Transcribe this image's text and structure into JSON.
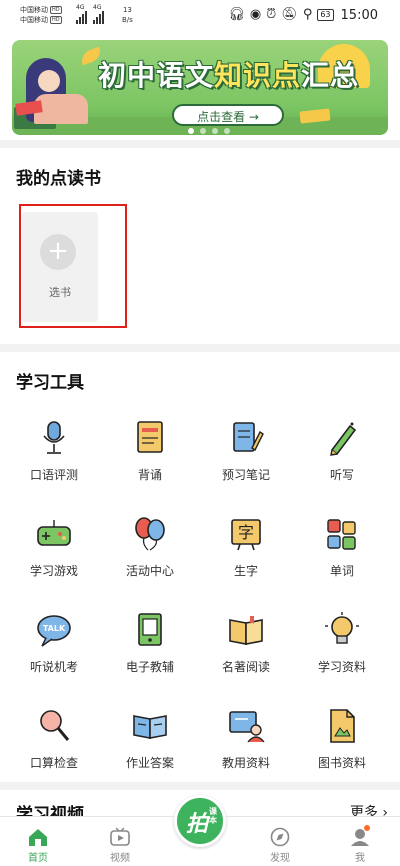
{
  "status_bar": {
    "carrier_1": "中国移动",
    "carrier_2": "中国移动",
    "hd_badge": "HD",
    "signal_1": "4G",
    "signal_2": "4G",
    "net_speed": "13",
    "net_speed_unit": "B/s",
    "battery": "63",
    "time": "15:00"
  },
  "banner": {
    "title_part1": "初中语文",
    "title_highlight": "知识点",
    "title_part2": "汇总",
    "button_label": "点击查看 →",
    "dots_total": 4,
    "dots_active": 0
  },
  "my_books": {
    "title": "我的点读书",
    "add_label": "选书"
  },
  "tools": {
    "title": "学习工具",
    "items": [
      {
        "label": "口语评测",
        "icon": "microphone-icon"
      },
      {
        "label": "背诵",
        "icon": "book-icon"
      },
      {
        "label": "预习笔记",
        "icon": "notebook-pen-icon"
      },
      {
        "label": "听写",
        "icon": "pencil-icon"
      },
      {
        "label": "学习游戏",
        "icon": "gamepad-icon"
      },
      {
        "label": "活动中心",
        "icon": "balloons-icon"
      },
      {
        "label": "生字",
        "icon": "character-board-icon"
      },
      {
        "label": "单词",
        "icon": "letter-blocks-icon"
      },
      {
        "label": "听说机考",
        "icon": "talk-bubble-icon"
      },
      {
        "label": "电子教辅",
        "icon": "ebook-icon"
      },
      {
        "label": "名著阅读",
        "icon": "open-book-icon"
      },
      {
        "label": "学习资料",
        "icon": "lightbulb-icon"
      },
      {
        "label": "口算检查",
        "icon": "magnifier-icon"
      },
      {
        "label": "作业答案",
        "icon": "answer-book-icon"
      },
      {
        "label": "教用资料",
        "icon": "teacher-board-icon"
      },
      {
        "label": "图书资料",
        "icon": "document-icon"
      }
    ]
  },
  "videos": {
    "title": "学习视频",
    "more_label": "更多"
  },
  "bottom_nav": {
    "home": "首页",
    "video": "视频",
    "center_main": "拍",
    "center_sub": "课本",
    "discover": "发现",
    "me": "我"
  },
  "colors": {
    "brand_green": "#3db35d",
    "highlight_red": "#e0201b",
    "notification_dot": "#ff6a2a"
  }
}
